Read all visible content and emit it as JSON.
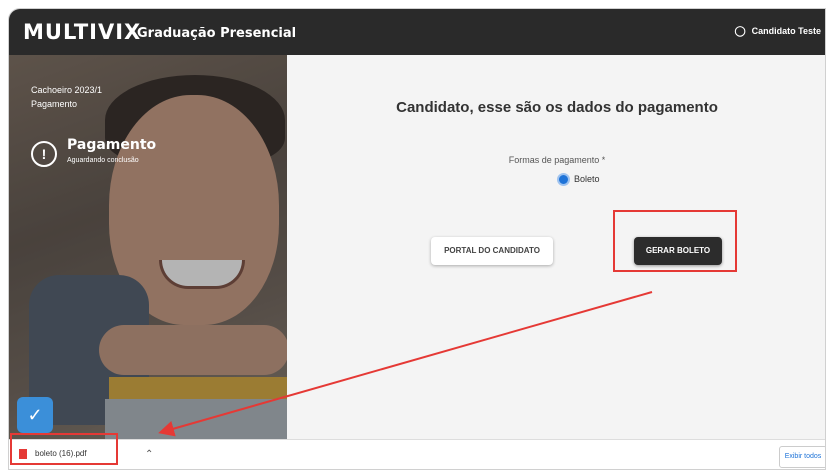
{
  "header": {
    "logo": "MULTIVIX",
    "subtitle": "Graduação Presencial",
    "user_name": "Candidato Teste",
    "user_icon": "user-icon"
  },
  "sidebar": {
    "campus": "Cachoeiro 2023/1",
    "section": "Pagamento",
    "step_title": "Pagamento",
    "step_status": "Aguardando conclusão",
    "step_icon": "alert-circle-icon",
    "badge_icon": "shield-check-icon"
  },
  "main": {
    "heading": "Candidato, esse são os dados do pagamento",
    "payment_label": "Formas de pagamento *",
    "payment_option": "Boleto",
    "portal_button": "PORTAL DO CANDIDATO",
    "generate_button": "GERAR BOLETO"
  },
  "downloads": {
    "file_name": "boleto (16).pdf",
    "show_all": "Exibir todos"
  },
  "colors": {
    "accent": "#1e73d8",
    "highlight": "#e53935",
    "topbar": "#2a2a2a"
  }
}
